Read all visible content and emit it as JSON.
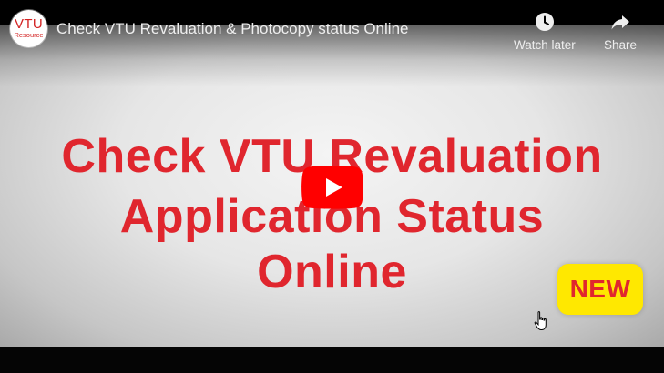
{
  "channel": {
    "avatar_main": "VTU",
    "avatar_sub": "Resource"
  },
  "video": {
    "title": "Check VTU Revaluation & Photocopy status Online"
  },
  "actions": {
    "watch_later": "Watch later",
    "share": "Share"
  },
  "slide": {
    "line1": "Check VTU Revaluation",
    "line2": "Application Status",
    "line3": "Online",
    "badge": "NEW"
  },
  "colors": {
    "slide_text": "#e0262e",
    "badge_bg": "#ffe800",
    "play_button": "#ff0000"
  },
  "icons": {
    "watch_later": "clock-icon",
    "share": "share-arrow-icon",
    "play": "play-icon",
    "cursor": "hand-pointer-icon"
  }
}
